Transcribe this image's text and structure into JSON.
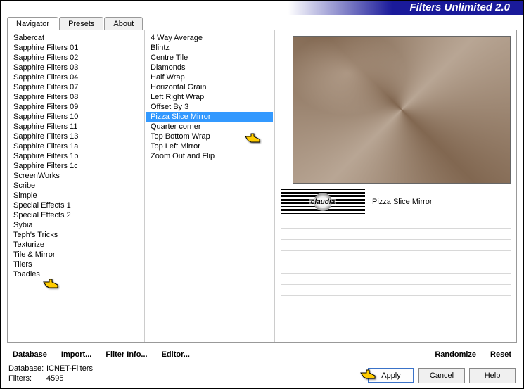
{
  "title": "Filters Unlimited 2.0",
  "tabs": [
    "Navigator",
    "Presets",
    "About"
  ],
  "active_tab": 0,
  "categories": [
    "Sabercat",
    "Sapphire Filters 01",
    "Sapphire Filters 02",
    "Sapphire Filters 03",
    "Sapphire Filters 04",
    "Sapphire Filters 07",
    "Sapphire Filters 08",
    "Sapphire Filters 09",
    "Sapphire Filters 10",
    "Sapphire Filters 11",
    "Sapphire Filters 13",
    "Sapphire Filters 1a",
    "Sapphire Filters 1b",
    "Sapphire Filters 1c",
    "ScreenWorks",
    "Scribe",
    "Simple",
    "Special Effects 1",
    "Special Effects 2",
    "Sybia",
    "Teph's Tricks",
    "Texturize",
    "Tile & Mirror",
    "Tilers",
    "Toadies"
  ],
  "selected_category": "Simple",
  "filters": [
    "4 Way Average",
    "Blintz",
    "Centre Tile",
    "Diamonds",
    "Half Wrap",
    "Horizontal Grain",
    "Left Right Wrap",
    "Offset By 3",
    "Pizza Slice Mirror",
    "Quarter corner",
    "Top Bottom Wrap",
    "Top Left Mirror",
    "Zoom Out and Flip"
  ],
  "selected_filter": "Pizza Slice Mirror",
  "watermark_text": "claudia",
  "current_filter_label": "Pizza Slice Mirror",
  "buttons": {
    "database": "Database",
    "import": "Import...",
    "filter_info": "Filter Info...",
    "editor": "Editor...",
    "randomize": "Randomize",
    "reset": "Reset",
    "apply": "Apply",
    "cancel": "Cancel",
    "help": "Help"
  },
  "footer": {
    "db_label": "Database:",
    "db_value": "ICNET-Filters",
    "filters_label": "Filters:",
    "filters_value": "4595"
  }
}
